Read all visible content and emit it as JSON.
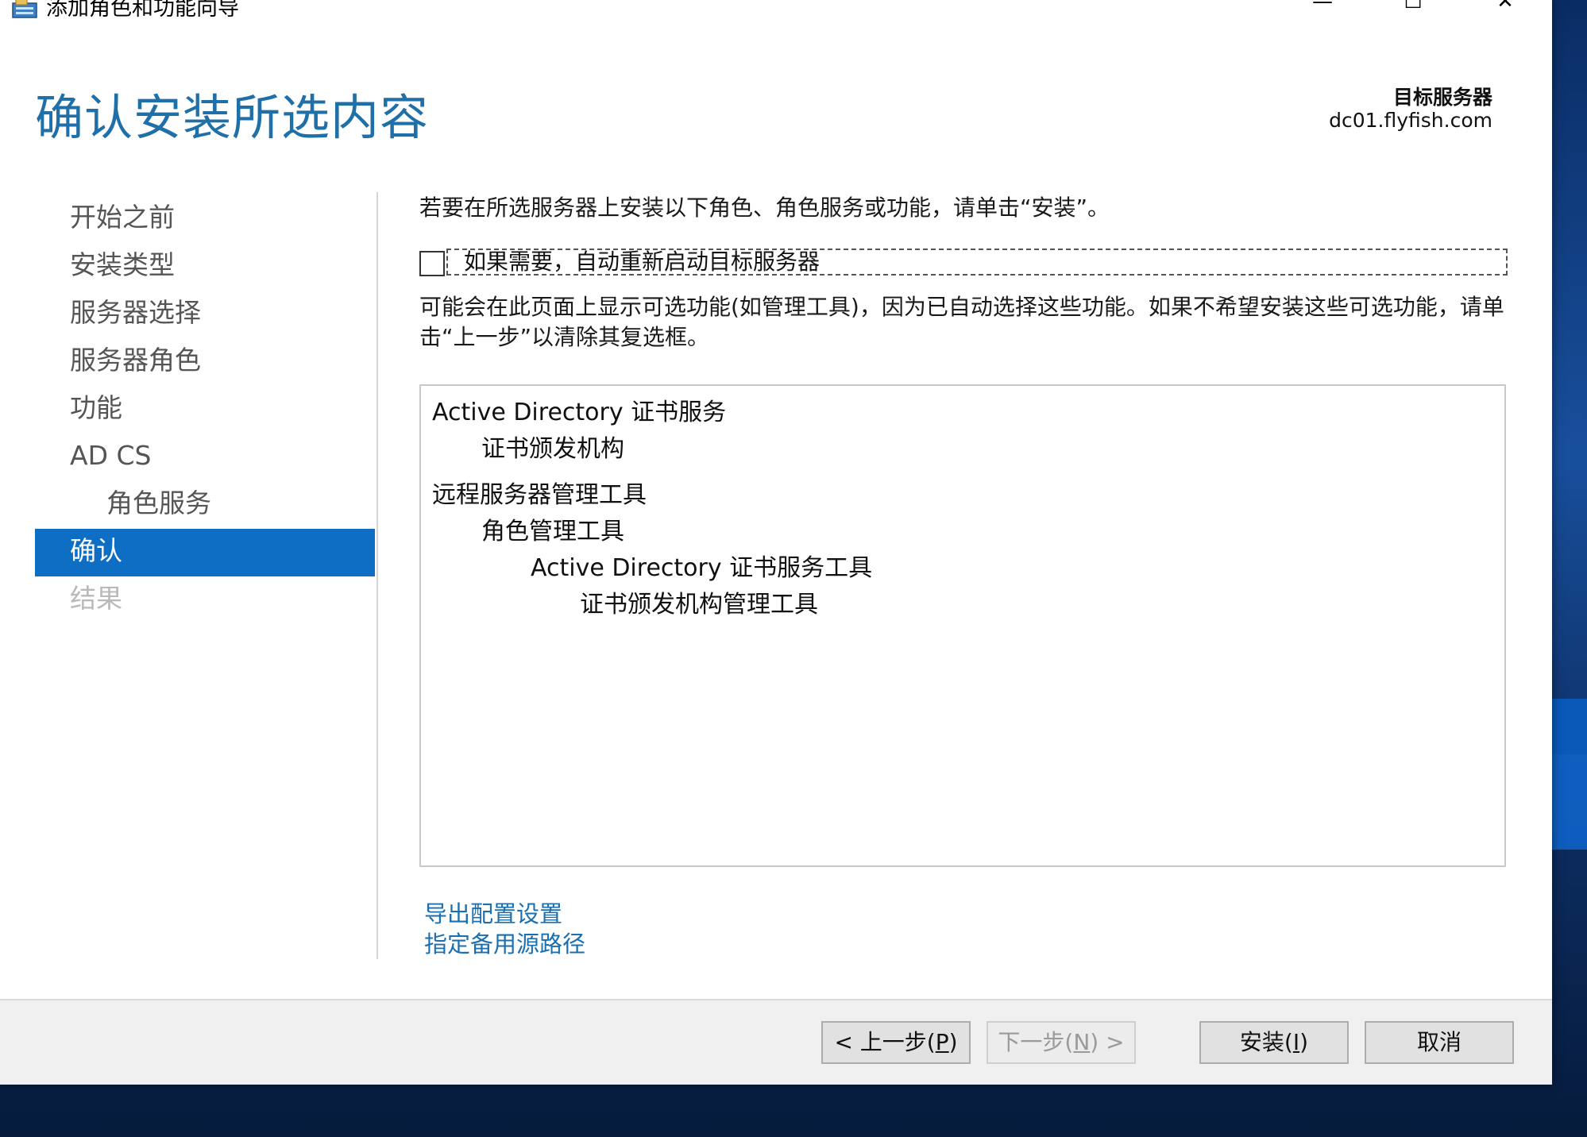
{
  "window": {
    "title": "添加角色和功能向导",
    "minimize_symbol": "—",
    "maximize_symbol": "☐",
    "close_symbol": "✕"
  },
  "header": {
    "heading": "确认安装所选内容",
    "target_label": "目标服务器",
    "target_server": "dc01.flyfish.com"
  },
  "nav": {
    "items": [
      {
        "label": "开始之前",
        "state": "normal"
      },
      {
        "label": "安装类型",
        "state": "normal"
      },
      {
        "label": "服务器选择",
        "state": "normal"
      },
      {
        "label": "服务器角色",
        "state": "normal"
      },
      {
        "label": "功能",
        "state": "normal"
      },
      {
        "label": "AD CS",
        "state": "normal"
      },
      {
        "label": "角色服务",
        "state": "sub"
      },
      {
        "label": "确认",
        "state": "active"
      },
      {
        "label": "结果",
        "state": "disabled"
      }
    ]
  },
  "content": {
    "intro": "若要在所选服务器上安装以下角色、角色服务或功能，请单击“安装”。",
    "restart_checkbox_label": "如果需要，自动重新启动目标服务器",
    "restart_checked": false,
    "note": "可能会在此页面上显示可选功能(如管理工具)，因为已自动选择这些功能。如果不希望安装这些可选功能，请单击“上一步”以清除其复选框。",
    "features": [
      {
        "label": "Active Directory 证书服务",
        "level": 0
      },
      {
        "label": "证书颁发机构",
        "level": 1
      },
      {
        "label": "远程服务器管理工具",
        "level": 0
      },
      {
        "label": "角色管理工具",
        "level": 1
      },
      {
        "label": "Active Directory 证书服务工具",
        "level": 2
      },
      {
        "label": "证书颁发机构管理工具",
        "level": 3
      }
    ],
    "links": {
      "export": "导出配置设置",
      "alternate_source": "指定备用源路径"
    }
  },
  "footer": {
    "prev": {
      "pre": "< 上一步(",
      "key": "P",
      "post": ")"
    },
    "next": {
      "pre": "下一步(",
      "key": "N",
      "post": ") >"
    },
    "install": {
      "pre": "安装(",
      "key": "I",
      "post": ")"
    },
    "cancel": {
      "label": "取消"
    }
  }
}
